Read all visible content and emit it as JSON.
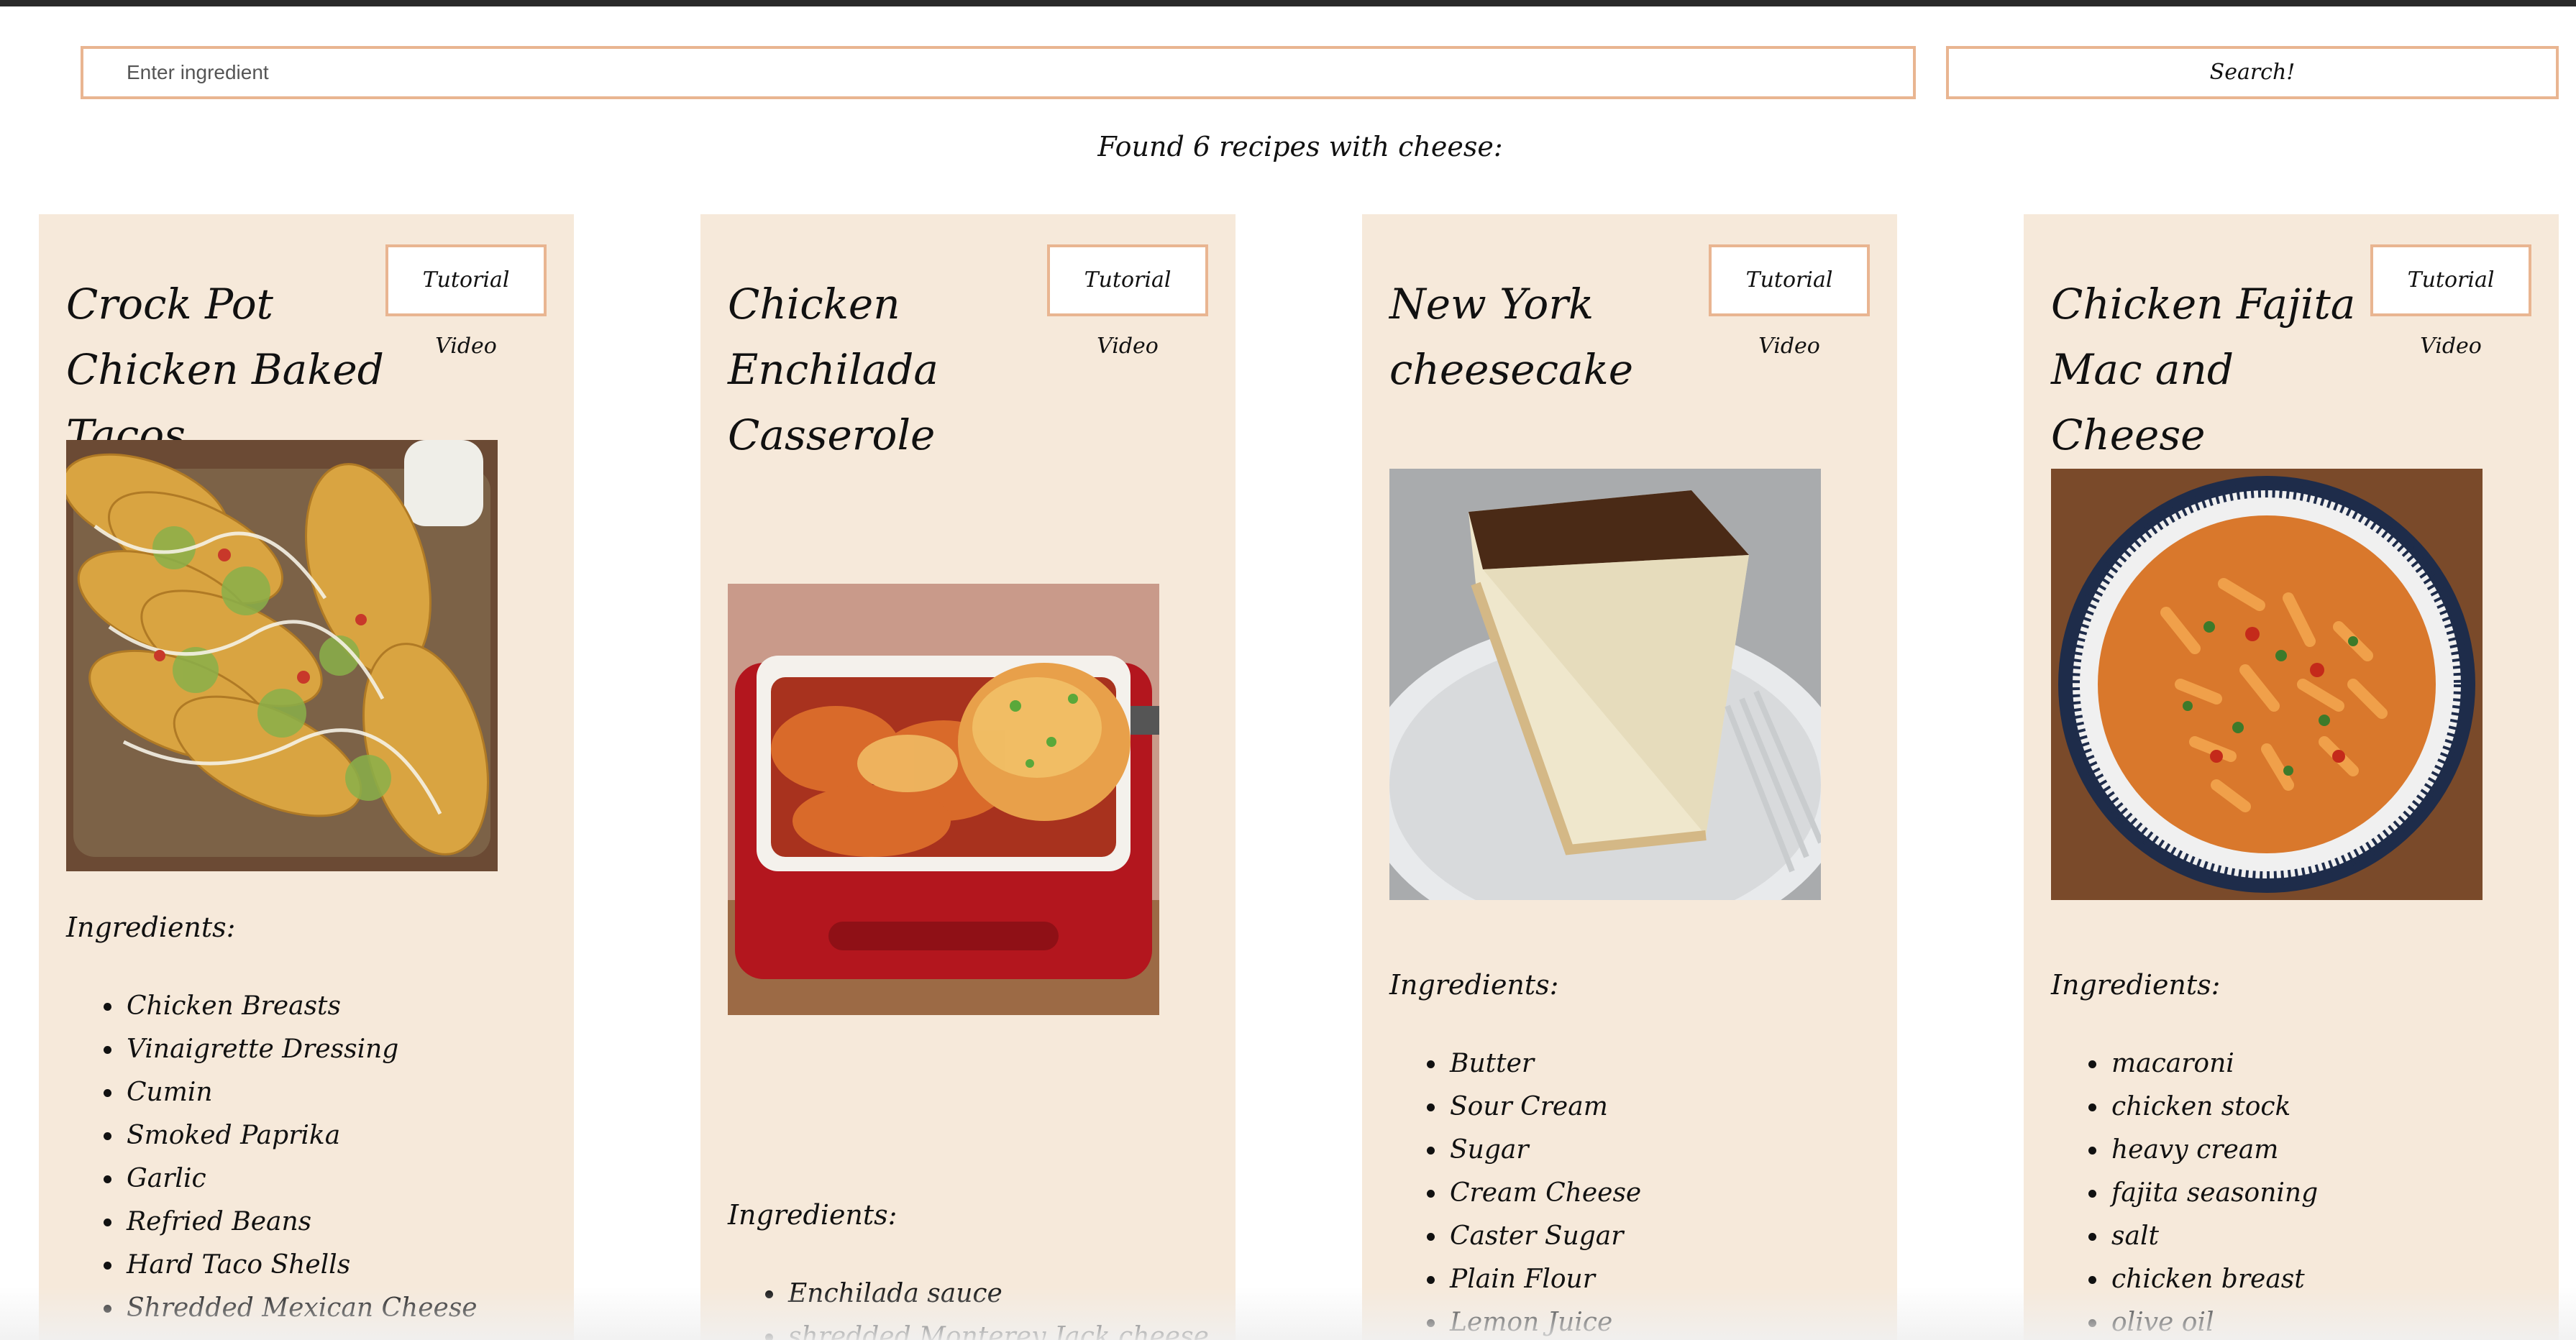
{
  "search": {
    "placeholder": "Enter ingredient",
    "button_label": "Search!"
  },
  "results_text": "Found 6 recipes with cheese:",
  "cards": [
    {
      "title": "Crock Pot Chicken Baked Tacos",
      "tutorial_label": "Tutorial Video",
      "ingredients_label": "Ingredients:",
      "ingredients": [
        "Chicken Breasts",
        "Vinaigrette Dressing",
        "Cumin",
        "Smoked Paprika",
        "Garlic",
        "Refried Beans",
        "Hard Taco Shells",
        "Shredded Mexican Cheese"
      ]
    },
    {
      "title": "Chicken Enchilada Casserole",
      "tutorial_label": "Tutorial Video",
      "ingredients_label": "Ingredients:",
      "ingredients": [
        "Enchilada sauce",
        "shredded Monterey Jack cheese"
      ]
    },
    {
      "title": "New York cheesecake",
      "tutorial_label": "Tutorial Video",
      "ingredients_label": "Ingredients:",
      "ingredients": [
        "Butter",
        "Sour Cream",
        "Sugar",
        "Cream Cheese",
        "Caster Sugar",
        "Plain Flour",
        "Lemon Juice"
      ]
    },
    {
      "title": "Chicken Fajita Mac and Cheese",
      "tutorial_label": "Tutorial Video",
      "ingredients_label": "Ingredients:",
      "ingredients": [
        "macaroni",
        "chicken stock",
        "heavy cream",
        "fajita seasoning",
        "salt",
        "chicken breast",
        "olive oil"
      ]
    }
  ]
}
